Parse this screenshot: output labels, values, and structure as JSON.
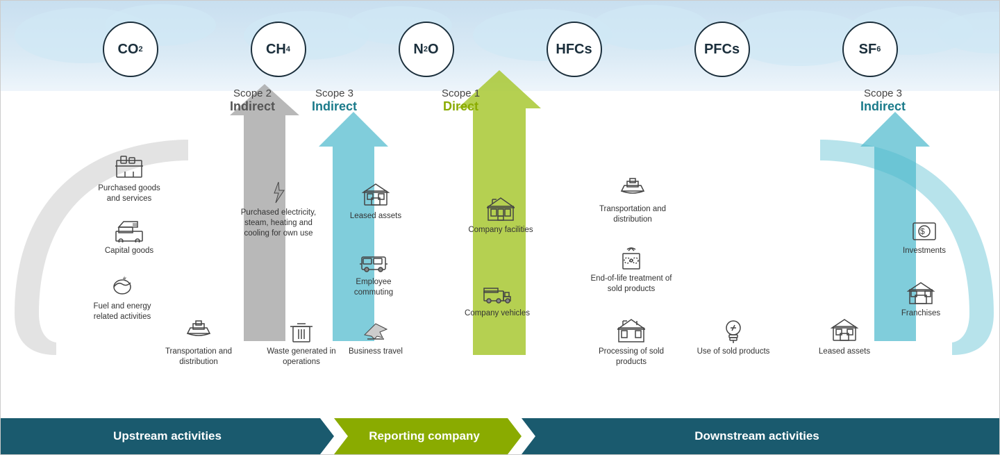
{
  "scopes": {
    "scope2": {
      "title": "Scope 2",
      "subtitle": "Indirect"
    },
    "scope3upstream": {
      "title": "Scope 3",
      "subtitle": "Indirect"
    },
    "scope1": {
      "title": "Scope 1",
      "subtitle": "Direct"
    },
    "scope3downstream": {
      "title": "Scope 3",
      "subtitle": "Indirect"
    }
  },
  "gases": {
    "co2": "CO₂",
    "ch4": "CH₄",
    "n2o": "N₂O",
    "hfcs": "HFCs",
    "pfcs": "PFCs",
    "sf6": "SF₆"
  },
  "items": {
    "purchased_goods": {
      "label": "Purchased goods and services"
    },
    "capital_goods": {
      "label": "Capital goods"
    },
    "fuel_energy": {
      "label": "Fuel and energy related activities"
    },
    "transport_upstream": {
      "label": "Transportation and distribution"
    },
    "purchased_elec": {
      "label": "Purchased electricity, steam, heating and cooling for own use"
    },
    "leased_upstream": {
      "label": "Leased assets"
    },
    "employee_commuting": {
      "label": "Employee commuting"
    },
    "business_travel": {
      "label": "Business travel"
    },
    "waste": {
      "label": "Waste generated in operations"
    },
    "company_facilities": {
      "label": "Company facilities"
    },
    "company_vehicles": {
      "label": "Company vehicles"
    },
    "transport_downstream": {
      "label": "Transportation and distribution"
    },
    "end_of_life": {
      "label": "End-of-life treatment of sold products"
    },
    "processing": {
      "label": "Processing of sold products"
    },
    "use_sold": {
      "label": "Use of sold products"
    },
    "investments": {
      "label": "Investments"
    },
    "franchises": {
      "label": "Franchises"
    },
    "leased_downstream": {
      "label": "Leased assets"
    }
  },
  "bottomBar": {
    "upstream": "Upstream activities",
    "reporting": "Reporting company",
    "downstream": "Downstream activities"
  }
}
